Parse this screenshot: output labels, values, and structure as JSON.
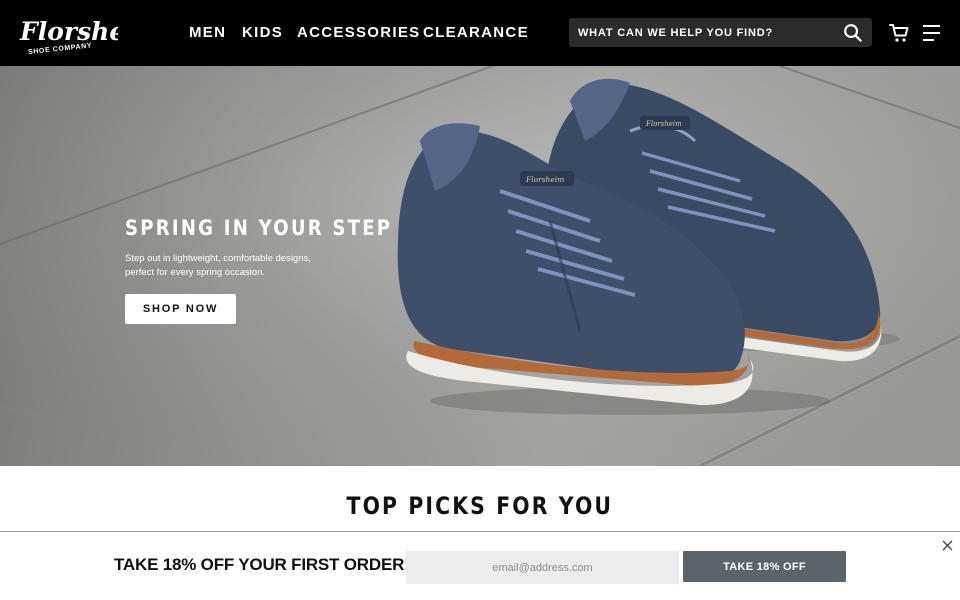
{
  "brand": {
    "name": "Florsheim",
    "tagline": "SHOE COMPANY"
  },
  "nav": {
    "items": [
      {
        "label": "MEN"
      },
      {
        "label": "KIDS"
      },
      {
        "label": "ACCESSORIES"
      },
      {
        "label": "CLEARANCE"
      }
    ]
  },
  "search": {
    "placeholder": "WHAT CAN WE HELP YOU FIND?",
    "icon": "search-icon"
  },
  "header_icons": [
    "cart-icon",
    "menu-icon"
  ],
  "hero": {
    "title": "SPRING IN YOUR STEP",
    "subtitle": "Step out in lightweight, comfortable designs, perfect for every spring occasion.",
    "cta_label": "SHOP NOW"
  },
  "section": {
    "title": "TOP PICKS FOR YOU"
  },
  "promo": {
    "text": "TAKE 18% OFF YOUR FIRST ORDER!",
    "email_placeholder": "email@address.com",
    "button_label": "TAKE 18% OFF",
    "close_icon": "close-icon"
  },
  "colors": {
    "header_bg": "#000000",
    "search_bg": "#2b2b2b",
    "offer_button_bg": "#5b6468",
    "shoe_navy": "#3b4a63",
    "sole_tan": "#b36a3a"
  }
}
